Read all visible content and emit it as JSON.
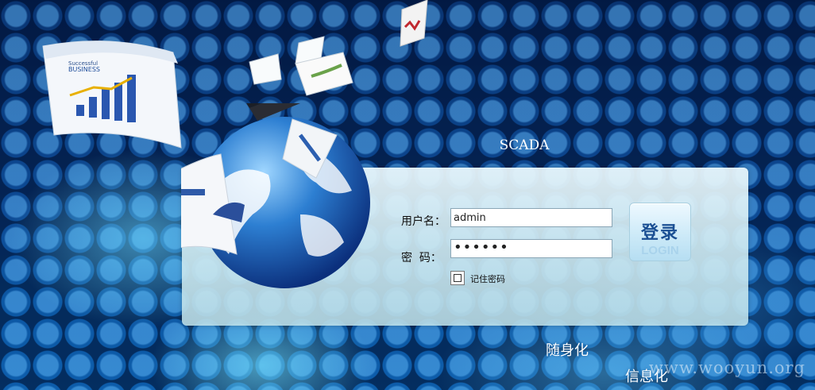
{
  "page": {
    "title": "SCADA",
    "slogans": [
      "随身化",
      "信息化"
    ],
    "watermark": "www.wooyun.org"
  },
  "login": {
    "username_label": "用户名：",
    "username_value": "admin",
    "password_label": "密  码：",
    "password_value": "••••••",
    "remember_label": "记住密码",
    "remember_checked": false,
    "button_cn": "登录",
    "button_en": "LOGIN"
  },
  "decor": {
    "graphic_text": [
      "Successful",
      "BUSINESS",
      "Successful",
      "BUSINESS"
    ]
  },
  "colors": {
    "background": "#0a3a78",
    "panel": "#d7eef3",
    "button_text": "#1a4f93"
  }
}
